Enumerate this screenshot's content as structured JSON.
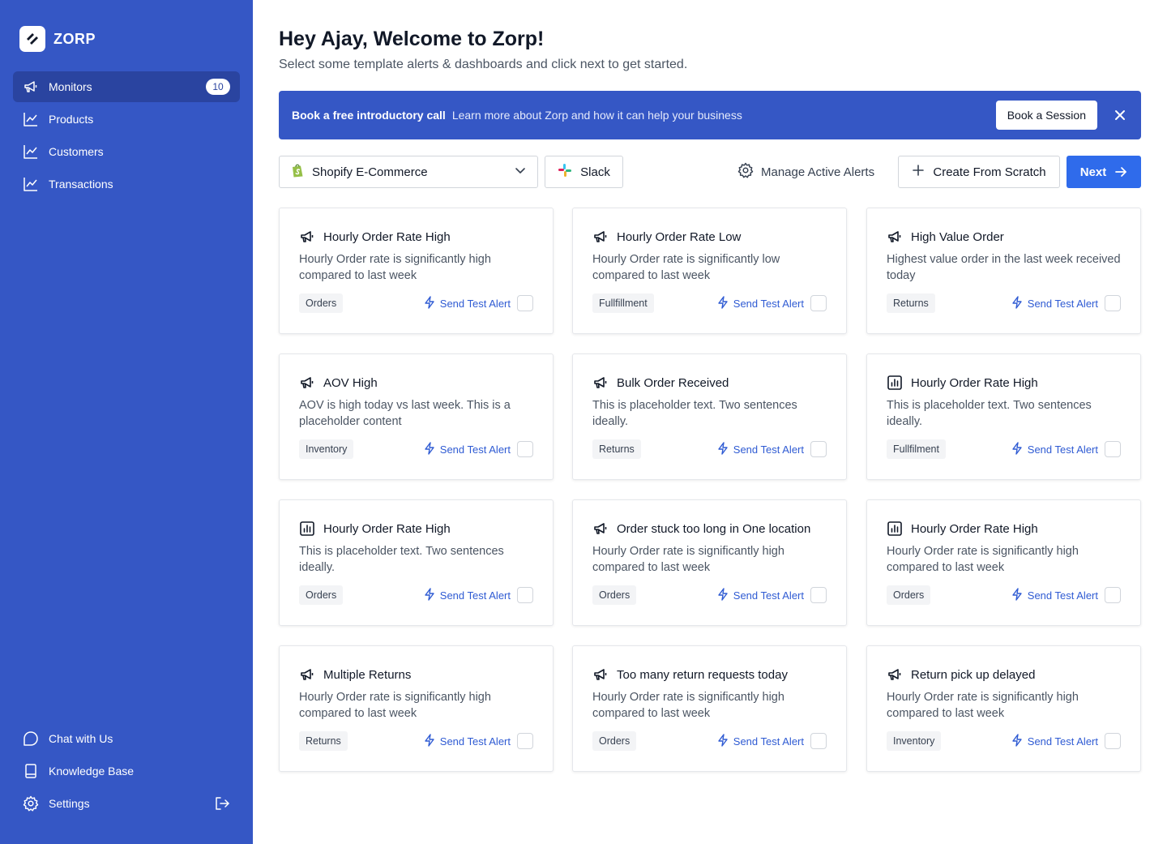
{
  "sidebar": {
    "brand": "ZORP",
    "items": [
      {
        "label": "Monitors",
        "icon": "megaphone-icon",
        "badge": "10",
        "active": true
      },
      {
        "label": "Products",
        "icon": "trend-chart-icon"
      },
      {
        "label": "Customers",
        "icon": "trend-chart-icon"
      },
      {
        "label": "Transactions",
        "icon": "trend-chart-icon"
      }
    ],
    "bottom": [
      {
        "label": "Chat with Us",
        "icon": "chat-icon"
      },
      {
        "label": "Knowledge Base",
        "icon": "book-icon"
      },
      {
        "label": "Settings",
        "icon": "gear-icon"
      }
    ]
  },
  "header": {
    "title": "Hey Ajay, Welcome to Zorp!",
    "subtitle": "Select some template alerts & dashboards and click next to get started."
  },
  "banner": {
    "title": "Book a free introductory call",
    "text": "Learn more about Zorp and how it can help your business",
    "button": "Book a Session"
  },
  "toolbar": {
    "integration_select": "Shopify E-Commerce",
    "slack": "Slack",
    "manage": "Manage Active Alerts",
    "create": "Create From Scratch",
    "next": "Next"
  },
  "send_label": "Send Test Alert",
  "cards": [
    {
      "icon": "megaphone-icon",
      "title": "Hourly Order Rate High",
      "desc": "Hourly Order rate is significantly high compared to last week",
      "tag": "Orders"
    },
    {
      "icon": "megaphone-icon",
      "title": "Hourly Order Rate Low",
      "desc": "Hourly Order rate is significantly low compared to last week",
      "tag": "Fullfillment"
    },
    {
      "icon": "megaphone-icon",
      "title": "High Value Order",
      "desc": "Highest value order in the last week received today",
      "tag": "Returns"
    },
    {
      "icon": "megaphone-icon",
      "title": "AOV High",
      "desc": "AOV is high today vs last week. This is a placeholder content",
      "tag": "Inventory"
    },
    {
      "icon": "megaphone-icon",
      "title": "Bulk Order Received",
      "desc": "This is placeholder text. Two sentences ideally.",
      "tag": "Returns"
    },
    {
      "icon": "bar-chart-icon",
      "title": "Hourly Order Rate High",
      "desc": "This is placeholder text. Two sentences ideally.",
      "tag": "Fullfilment"
    },
    {
      "icon": "bar-chart-icon",
      "title": "Hourly Order Rate High",
      "desc": "This is placeholder text. Two sentences ideally.",
      "tag": "Orders"
    },
    {
      "icon": "megaphone-icon",
      "title": "Order stuck too long in One location",
      "desc": "Hourly Order rate is significantly high compared to last week",
      "tag": "Orders"
    },
    {
      "icon": "bar-chart-icon",
      "title": "Hourly Order Rate High",
      "desc": "Hourly Order rate is significantly high compared to last week",
      "tag": "Orders"
    },
    {
      "icon": "megaphone-icon",
      "title": "Multiple Returns",
      "desc": "Hourly Order rate is significantly high compared to last week",
      "tag": "Returns"
    },
    {
      "icon": "megaphone-icon",
      "title": "Too many return requests today",
      "desc": "Hourly Order rate is significantly high compared to last week",
      "tag": "Orders"
    },
    {
      "icon": "megaphone-icon",
      "title": "Return pick up delayed",
      "desc": "Hourly Order rate is significantly high compared to last week",
      "tag": "Inventory"
    }
  ],
  "colors": {
    "sidebar": "#3557C5",
    "sidebar_active": "#2A44A0",
    "primary": "#2F6BEB",
    "link": "#2F5BD3"
  }
}
